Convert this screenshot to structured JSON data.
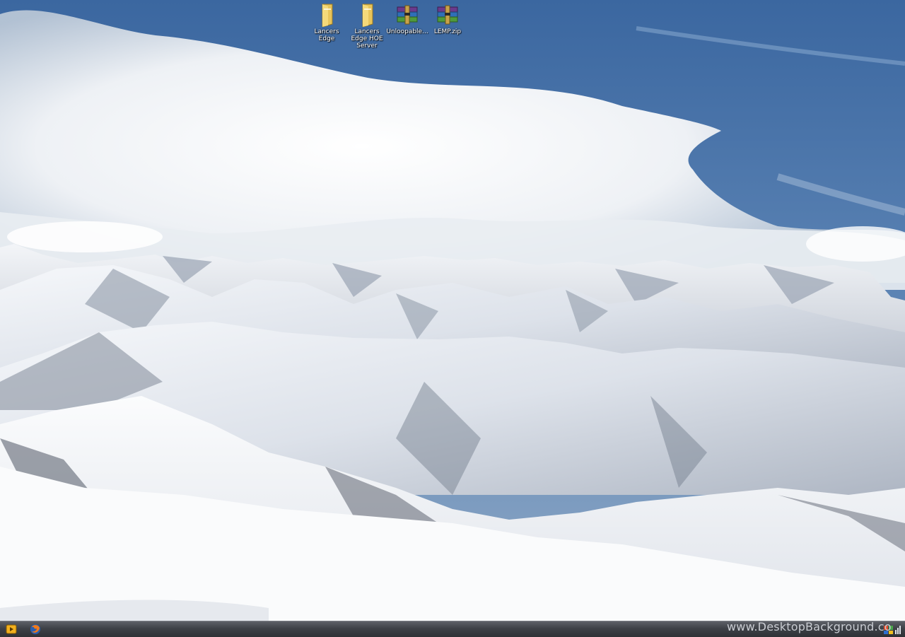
{
  "desktop": {
    "icons": [
      {
        "label": "Lancers Edge",
        "icon": "folder-icon"
      },
      {
        "label": "Lancers Edge HOE Server",
        "icon": "folder-icon"
      },
      {
        "label": "Unloopable...",
        "icon": "winrar-archive-icon"
      },
      {
        "label": "LEMP.zip",
        "icon": "winrar-archive-icon"
      }
    ]
  },
  "taskbar": {
    "start_icon": "media-player-icon",
    "quicklaunch_icon": "firefox-icon",
    "watermark": "www.DesktopBackground.co",
    "tray_icon": "network-icon"
  },
  "colors": {
    "sky": "#4a74a6",
    "taskbar": "#3e4147",
    "folder": "#e8c45a",
    "archive_purple": "#6b3a8c"
  }
}
